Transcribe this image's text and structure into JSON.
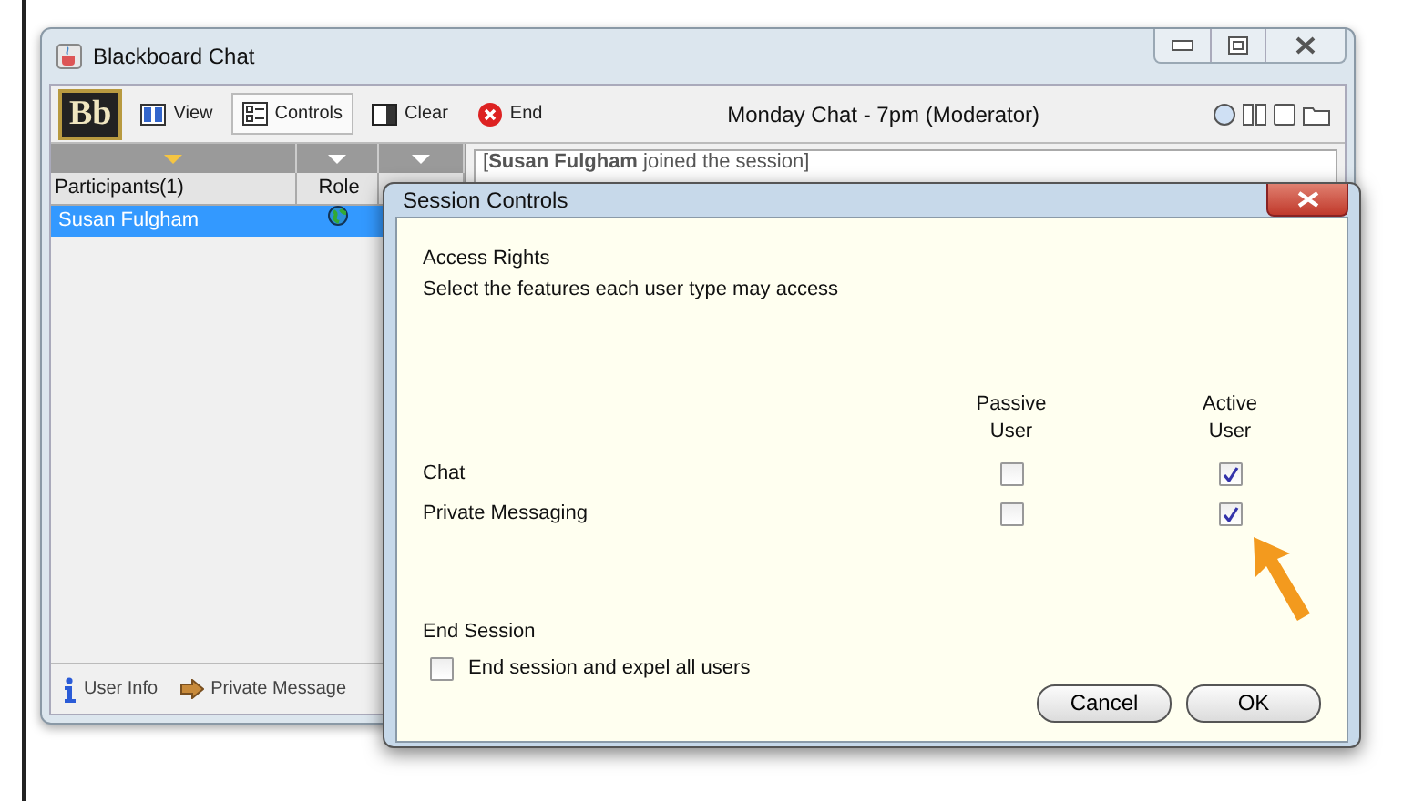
{
  "window": {
    "title": "Blackboard Chat"
  },
  "toolbar": {
    "logo": "Bb",
    "buttons": [
      {
        "kind": "view",
        "label": "View",
        "selected": false
      },
      {
        "kind": "controls",
        "label": "Controls",
        "selected": true
      },
      {
        "kind": "clear",
        "label": "Clear",
        "selected": false
      },
      {
        "kind": "end",
        "label": "End",
        "selected": false
      }
    ],
    "session_title": "Monday Chat - 7pm (Moderator)"
  },
  "participants": {
    "columns": [
      "Participants(1)",
      "Role"
    ],
    "rows": [
      {
        "name": "Susan Fulgham",
        "selected": true
      }
    ]
  },
  "footer": [
    {
      "kind": "info",
      "label": "User Info"
    },
    {
      "kind": "message",
      "label": "Private Message"
    }
  ],
  "chat": {
    "messages": [
      "[**Susan Fulgham** joined the session]"
    ]
  },
  "dialog": {
    "title": "Session Controls",
    "heading": "Access Rights",
    "instruction": "Select the features each user type may access",
    "columns": [
      "Passive User",
      "Active User"
    ],
    "features": [
      {
        "label": "Chat",
        "passive": false,
        "active": true
      },
      {
        "label": "Private Messaging",
        "passive": false,
        "active": true
      }
    ],
    "end_heading": "End Session",
    "end_option": {
      "label": "End session and expel all users",
      "checked": false
    },
    "buttons": [
      "Cancel",
      "OK"
    ]
  }
}
